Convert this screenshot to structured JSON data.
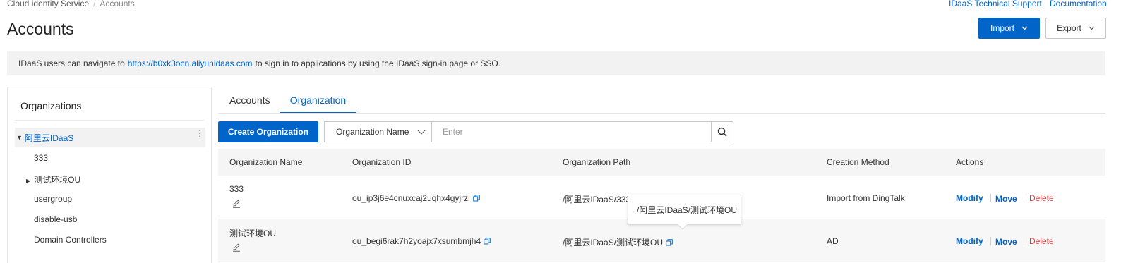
{
  "breadcrumb": {
    "parent": "Cloud identity Service",
    "separator": "/",
    "current": "Accounts"
  },
  "top_links": {
    "support": "IDaaS Technical Support",
    "docs": "Documentation"
  },
  "page_title": "Accounts",
  "header_buttons": {
    "import": "Import",
    "export": "Export"
  },
  "notice": {
    "prefix": "IDaaS users can navigate to",
    "url": "https://b0xk3ocn.aliyunidaas.com",
    "suffix": "to sign in to applications by using the IDaaS sign-in page or SSO."
  },
  "org_panel": {
    "title": "Organizations",
    "root": "阿里云IDaaS",
    "children": [
      "333",
      "测试环境OU",
      "usergroup",
      "disable-usb",
      "Domain Controllers"
    ]
  },
  "tabs": [
    "Accounts",
    "Organization"
  ],
  "active_tab": "Organization",
  "toolbar": {
    "create_label": "Create Organization",
    "filter_field": "Organization Name",
    "search_placeholder": "Enter"
  },
  "table": {
    "columns": [
      "Organization Name",
      "Organization ID",
      "Organization Path",
      "Creation Method",
      "Actions"
    ],
    "rows": [
      {
        "name": "333",
        "id": "ou_ip3j6e4cnuxcaj2uqhx4gyjrzi",
        "path": "/阿里云IDaaS/333",
        "method": "Import from DingTalk"
      },
      {
        "name": "测试环境OU",
        "id": "ou_begi6rak7h2yoajx7xsumbmjh4",
        "path": "/阿里云IDaaS/测试环境OU",
        "method": "AD"
      }
    ],
    "actions": {
      "modify": "Modify",
      "move": "Move",
      "delete": "Delete"
    }
  },
  "tooltip": {
    "text": "/阿里云IDaaS/测试环境OU"
  },
  "colors": {
    "primary": "#0064c8",
    "danger": "#e4393c",
    "notice_bg": "#f2f2f2"
  },
  "icons": [
    "edit-icon",
    "copy-icon",
    "search-icon",
    "chevron-down-icon",
    "tree-caret-icon",
    "kebab-icon"
  ]
}
